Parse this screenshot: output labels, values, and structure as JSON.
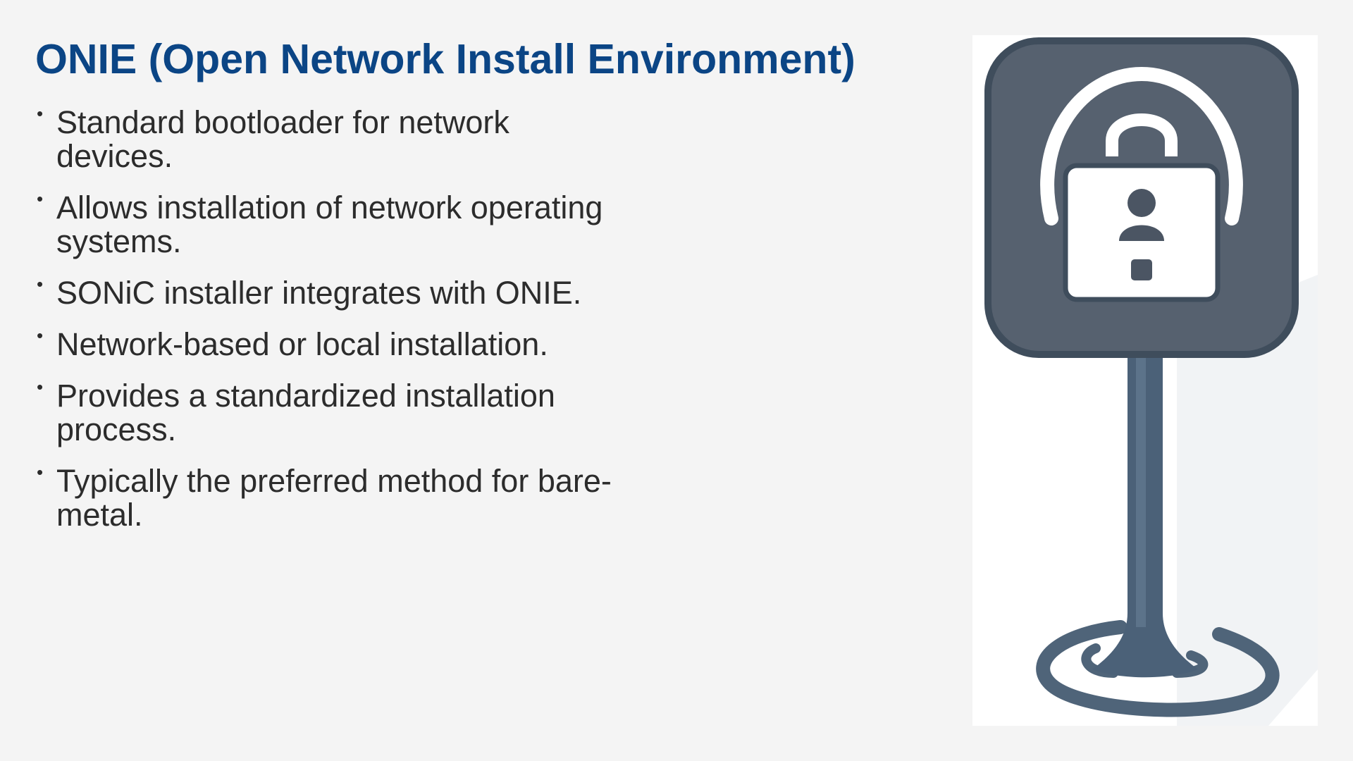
{
  "slide": {
    "title": "ONIE (Open Network Install Environment)",
    "bullets": [
      "Standard bootloader for network devices.",
      "Allows installation of network operating systems.",
      "SONiC installer integrates with ONIE.",
      "Network-based or local installation.",
      "Provides a standardized installation process.",
      "Typically the preferred method for bare-metal."
    ],
    "bullet_symbol": "•",
    "illustration": {
      "icon": "padlock-sign-icon",
      "colors": {
        "panel": "#56616f",
        "panel_border": "#3f4d5c",
        "post": "#4b6178",
        "lock_body": "#ffffff",
        "keyhole": "#4b5563"
      }
    },
    "colors": {
      "background": "#f4f4f4",
      "title": "#0b4585",
      "text": "#2c2c2c"
    }
  }
}
